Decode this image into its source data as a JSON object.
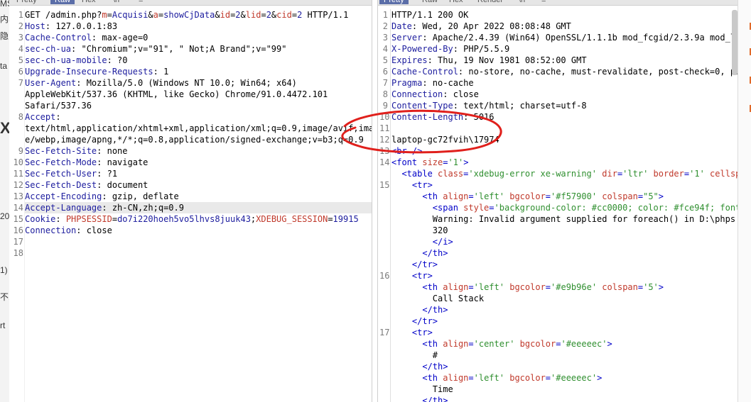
{
  "left_strip": {
    "fragments": [
      "MS",
      "内S",
      "隐",
      "ta",
      "X",
      "20",
      "1)",
      "不1",
      "rt"
    ]
  },
  "request": {
    "tabs": [
      "Pretty",
      "Raw",
      "Hex",
      "\\n",
      "≡"
    ],
    "active_tab": "Raw",
    "lines": [
      {
        "n": "1",
        "segs": [
          [
            "t",
            "GET /admin.php?"
          ],
          [
            "pk",
            "m"
          ],
          [
            "t",
            "="
          ],
          [
            "pv",
            "Acquisi"
          ],
          [
            "t",
            "&"
          ],
          [
            "pk",
            "a"
          ],
          [
            "t",
            "="
          ],
          [
            "pv",
            "showCjData"
          ],
          [
            "t",
            "&"
          ],
          [
            "pk",
            "id"
          ],
          [
            "t",
            "="
          ],
          [
            "pv",
            "2"
          ],
          [
            "t",
            "&"
          ],
          [
            "pk",
            "lid"
          ],
          [
            "t",
            "="
          ],
          [
            "pv",
            "2"
          ],
          [
            "t",
            "&"
          ],
          [
            "pk",
            "cid"
          ],
          [
            "t",
            "="
          ],
          [
            "pv",
            "2"
          ],
          [
            "t",
            " HTTP/1.1"
          ]
        ]
      },
      {
        "n": "2",
        "segs": [
          [
            "hn",
            "Host"
          ],
          [
            "t",
            ": 127.0.0.1:83"
          ]
        ]
      },
      {
        "n": "3",
        "segs": [
          [
            "hn",
            "Cache-Control"
          ],
          [
            "t",
            ": max-age=0"
          ]
        ]
      },
      {
        "n": "4",
        "segs": [
          [
            "hn",
            "sec-ch-ua"
          ],
          [
            "t",
            ": \"Chromium\";v=\"91\", \" Not;A Brand\";v=\"99\""
          ]
        ]
      },
      {
        "n": "5",
        "segs": [
          [
            "hn",
            "sec-ch-ua-mobile"
          ],
          [
            "t",
            ": ?0"
          ]
        ]
      },
      {
        "n": "6",
        "segs": [
          [
            "hn",
            "Upgrade-Insecure-Requests"
          ],
          [
            "t",
            ": 1"
          ]
        ]
      },
      {
        "n": "7",
        "segs": [
          [
            "hn",
            "User-Agent"
          ],
          [
            "t",
            ": Mozilla/5.0 (Windows NT 10.0; Win64; x64)"
          ]
        ]
      },
      {
        "n": "",
        "segs": [
          [
            "t",
            "AppleWebKit/537.36 (KHTML, like Gecko) Chrome/91.0.4472.101"
          ]
        ]
      },
      {
        "n": "",
        "segs": [
          [
            "t",
            "Safari/537.36"
          ]
        ]
      },
      {
        "n": "8",
        "segs": [
          [
            "hn",
            "Accept"
          ],
          [
            "t",
            ":"
          ]
        ]
      },
      {
        "n": "",
        "segs": [
          [
            "t",
            "text/html,application/xhtml+xml,application/xml;q=0.9,image/avif,imag"
          ]
        ]
      },
      {
        "n": "",
        "segs": [
          [
            "t",
            "e/webp,image/apng,*/*;q=0.8,application/signed-exchange;v=b3;q=0.9"
          ]
        ]
      },
      {
        "n": "9",
        "segs": [
          [
            "hn",
            "Sec-Fetch-Site"
          ],
          [
            "t",
            ": none"
          ]
        ]
      },
      {
        "n": "10",
        "segs": [
          [
            "hn",
            "Sec-Fetch-Mode"
          ],
          [
            "t",
            ": navigate"
          ]
        ]
      },
      {
        "n": "11",
        "segs": [
          [
            "hn",
            "Sec-Fetch-User"
          ],
          [
            "t",
            ": ?1"
          ]
        ]
      },
      {
        "n": "12",
        "segs": [
          [
            "hn",
            "Sec-Fetch-Dest"
          ],
          [
            "t",
            ": document"
          ]
        ]
      },
      {
        "n": "13",
        "segs": [
          [
            "hn",
            "Accept-Encoding"
          ],
          [
            "t",
            ": gzip, deflate"
          ]
        ]
      },
      {
        "n": "14",
        "hl": true,
        "segs": [
          [
            "hn",
            "Accept-Language"
          ],
          [
            "t",
            ": zh-CN,zh;q=0.9"
          ]
        ]
      },
      {
        "n": "15",
        "segs": [
          [
            "hn",
            "Cookie"
          ],
          [
            "t",
            ": "
          ],
          [
            "pk",
            "PHPSESSID"
          ],
          [
            "t",
            "="
          ],
          [
            "pv",
            "do7i220hoeh5vo5lhvs8juuk43"
          ],
          [
            "t",
            ";"
          ],
          [
            "pk",
            "XDEBUG_SESSION"
          ],
          [
            "t",
            "="
          ],
          [
            "pv",
            "19915"
          ]
        ]
      },
      {
        "n": "16",
        "segs": [
          [
            "hn",
            "Connection"
          ],
          [
            "t",
            ": close"
          ]
        ]
      },
      {
        "n": "17",
        "segs": []
      },
      {
        "n": "18",
        "segs": []
      }
    ]
  },
  "response": {
    "tabs": [
      "Pretty",
      "Raw",
      "Hex",
      "Render",
      "\\n",
      "≡"
    ],
    "active_tab": "Pretty",
    "lines": [
      {
        "n": "1",
        "segs": [
          [
            "t",
            "HTTP/1.1 200 OK"
          ]
        ]
      },
      {
        "n": "2",
        "segs": [
          [
            "hn",
            "Date"
          ],
          [
            "t",
            ": Wed, 20 Apr 2022 08:08:48 GMT"
          ]
        ]
      },
      {
        "n": "3",
        "segs": [
          [
            "hn",
            "Server"
          ],
          [
            "t",
            ": Apache/2.4.39 (Win64) OpenSSL/1.1.1b mod_fcgid/2.3.9a mod_lo"
          ]
        ]
      },
      {
        "n": "4",
        "segs": [
          [
            "hn",
            "X-Powered-By"
          ],
          [
            "t",
            ": PHP/5.5.9"
          ]
        ]
      },
      {
        "n": "5",
        "segs": [
          [
            "hn",
            "Expires"
          ],
          [
            "t",
            ": Thu, 19 Nov 1981 08:52:00 GMT"
          ]
        ]
      },
      {
        "n": "6",
        "segs": [
          [
            "hn",
            "Cache-Control"
          ],
          [
            "t",
            ": no-store, no-cache, must-revalidate, post-check=0, pr"
          ]
        ]
      },
      {
        "n": "7",
        "segs": [
          [
            "hn",
            "Pragma"
          ],
          [
            "t",
            ": no-cache"
          ]
        ]
      },
      {
        "n": "8",
        "segs": [
          [
            "hn",
            "Connection"
          ],
          [
            "t",
            ": close"
          ]
        ]
      },
      {
        "n": "9",
        "segs": [
          [
            "hn",
            "Content-Type"
          ],
          [
            "t",
            ": text/html; charset=utf-8"
          ]
        ]
      },
      {
        "n": "10",
        "segs": [
          [
            "hn",
            "Content-Length"
          ],
          [
            "t",
            ": 5016"
          ]
        ]
      },
      {
        "n": "11",
        "segs": []
      },
      {
        "n": "12",
        "segs": [
          [
            "t",
            "laptop-gc72fvih\\17974"
          ]
        ]
      },
      {
        "n": "13",
        "segs": [
          [
            "tg",
            "<br />"
          ]
        ]
      },
      {
        "n": "14",
        "segs": [
          [
            "tg",
            "<font "
          ],
          [
            "at",
            "size"
          ],
          [
            "tg",
            "="
          ],
          [
            "av",
            "'1'"
          ],
          [
            "tg",
            ">"
          ]
        ]
      },
      {
        "n": "",
        "segs": [
          [
            "t",
            "  "
          ],
          [
            "tg",
            "<table "
          ],
          [
            "at",
            "class"
          ],
          [
            "tg",
            "="
          ],
          [
            "av",
            "'xdebug-error xe-warning'"
          ],
          [
            "tg",
            " "
          ],
          [
            "at",
            "dir"
          ],
          [
            "tg",
            "="
          ],
          [
            "av",
            "'ltr'"
          ],
          [
            "tg",
            " "
          ],
          [
            "at",
            "border"
          ],
          [
            "tg",
            "="
          ],
          [
            "av",
            "'1'"
          ],
          [
            "tg",
            " "
          ],
          [
            "at",
            "cellsp"
          ]
        ]
      },
      {
        "n": "15",
        "segs": [
          [
            "t",
            "    "
          ],
          [
            "tg",
            "<tr>"
          ]
        ]
      },
      {
        "n": "",
        "segs": [
          [
            "t",
            "      "
          ],
          [
            "tg",
            "<th "
          ],
          [
            "at",
            "align"
          ],
          [
            "tg",
            "="
          ],
          [
            "av",
            "'left'"
          ],
          [
            "tg",
            " "
          ],
          [
            "at",
            "bgcolor"
          ],
          [
            "tg",
            "="
          ],
          [
            "av",
            "'#f57900'"
          ],
          [
            "tg",
            " "
          ],
          [
            "at",
            "colspan"
          ],
          [
            "tg",
            "="
          ],
          [
            "av",
            "\"5\""
          ],
          [
            "tg",
            ">"
          ]
        ]
      },
      {
        "n": "",
        "segs": [
          [
            "t",
            "        "
          ],
          [
            "tg",
            "<span "
          ],
          [
            "at",
            "style"
          ],
          [
            "tg",
            "="
          ],
          [
            "av",
            "'background-color: #cc0000; color: #fce94f; font"
          ]
        ]
      },
      {
        "n": "",
        "segs": [
          [
            "t",
            "        Warning: Invalid argument supplied for foreach() in D:\\phps"
          ]
        ]
      },
      {
        "n": "",
        "segs": [
          [
            "t",
            "        320"
          ]
        ]
      },
      {
        "n": "",
        "segs": [
          [
            "t",
            "        "
          ],
          [
            "tg",
            "</i>"
          ]
        ]
      },
      {
        "n": "",
        "segs": [
          [
            "t",
            "      "
          ],
          [
            "tg",
            "</th>"
          ]
        ]
      },
      {
        "n": "",
        "segs": [
          [
            "t",
            "    "
          ],
          [
            "tg",
            "</tr>"
          ]
        ]
      },
      {
        "n": "16",
        "segs": [
          [
            "t",
            "    "
          ],
          [
            "tg",
            "<tr>"
          ]
        ]
      },
      {
        "n": "",
        "segs": [
          [
            "t",
            "      "
          ],
          [
            "tg",
            "<th "
          ],
          [
            "at",
            "align"
          ],
          [
            "tg",
            "="
          ],
          [
            "av",
            "'left'"
          ],
          [
            "tg",
            " "
          ],
          [
            "at",
            "bgcolor"
          ],
          [
            "tg",
            "="
          ],
          [
            "av",
            "'#e9b96e'"
          ],
          [
            "tg",
            " "
          ],
          [
            "at",
            "colspan"
          ],
          [
            "tg",
            "="
          ],
          [
            "av",
            "'5'"
          ],
          [
            "tg",
            ">"
          ]
        ]
      },
      {
        "n": "",
        "segs": [
          [
            "t",
            "        Call Stack"
          ]
        ]
      },
      {
        "n": "",
        "segs": [
          [
            "t",
            "      "
          ],
          [
            "tg",
            "</th>"
          ]
        ]
      },
      {
        "n": "",
        "segs": [
          [
            "t",
            "    "
          ],
          [
            "tg",
            "</tr>"
          ]
        ]
      },
      {
        "n": "17",
        "segs": [
          [
            "t",
            "    "
          ],
          [
            "tg",
            "<tr>"
          ]
        ]
      },
      {
        "n": "",
        "segs": [
          [
            "t",
            "      "
          ],
          [
            "tg",
            "<th "
          ],
          [
            "at",
            "align"
          ],
          [
            "tg",
            "="
          ],
          [
            "av",
            "'center'"
          ],
          [
            "tg",
            " "
          ],
          [
            "at",
            "bgcolor"
          ],
          [
            "tg",
            "="
          ],
          [
            "av",
            "'#eeeeec'"
          ],
          [
            "tg",
            ">"
          ]
        ]
      },
      {
        "n": "",
        "segs": [
          [
            "t",
            "        #"
          ]
        ]
      },
      {
        "n": "",
        "segs": [
          [
            "t",
            "      "
          ],
          [
            "tg",
            "</th>"
          ]
        ]
      },
      {
        "n": "",
        "segs": [
          [
            "t",
            "      "
          ],
          [
            "tg",
            "<th "
          ],
          [
            "at",
            "align"
          ],
          [
            "tg",
            "="
          ],
          [
            "av",
            "'left'"
          ],
          [
            "tg",
            " "
          ],
          [
            "at",
            "bgcolor"
          ],
          [
            "tg",
            "="
          ],
          [
            "av",
            "'#eeeeec'"
          ],
          [
            "tg",
            ">"
          ]
        ]
      },
      {
        "n": "",
        "segs": [
          [
            "t",
            "        Time"
          ]
        ]
      },
      {
        "n": "",
        "segs": [
          [
            "t",
            "      "
          ],
          [
            "tg",
            "</th>"
          ]
        ]
      }
    ]
  },
  "annotation_color": "#e0201c"
}
